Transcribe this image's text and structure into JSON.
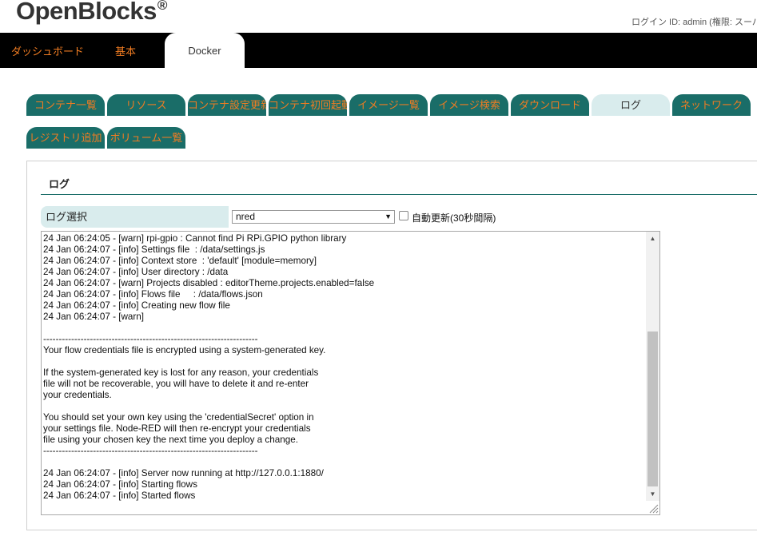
{
  "brand": {
    "name": "OpenBlocks",
    "reg": "®"
  },
  "login": {
    "text": "ログイン ID: admin (権限: スーパー"
  },
  "topnav": {
    "items": [
      {
        "label": "ダッシュボード"
      },
      {
        "label": "基本"
      },
      {
        "label": "Docker"
      }
    ],
    "active": "Docker"
  },
  "tabs": [
    {
      "label": "コンテナ一覧"
    },
    {
      "label": "リソース"
    },
    {
      "label": "コンテナ設定更新"
    },
    {
      "label": "コンテナ初回起動"
    },
    {
      "label": "イメージ一覧"
    },
    {
      "label": "イメージ検索"
    },
    {
      "label": "ダウンロード"
    },
    {
      "label": "ログ"
    },
    {
      "label": "ネットワーク"
    },
    {
      "label": "レジストリ追加"
    },
    {
      "label": "ボリューム一覧"
    }
  ],
  "active_tab": "ログ",
  "panel": {
    "title": "ログ",
    "log_select_label": "ログ選択",
    "selected_container": "nred",
    "auto_refresh_label": "自動更新(30秒間隔)",
    "auto_refresh_checked": false
  },
  "log": {
    "lines": [
      "24 Jan 06:24:05 - [warn] rpi-gpio : Cannot find Pi RPi.GPIO python library",
      "24 Jan 06:24:07 - [info] Settings file  : /data/settings.js",
      "24 Jan 06:24:07 - [info] Context store  : 'default' [module=memory]",
      "24 Jan 06:24:07 - [info] User directory : /data",
      "24 Jan 06:24:07 - [warn] Projects disabled : editorTheme.projects.enabled=false",
      "24 Jan 06:24:07 - [info] Flows file     : /data/flows.json",
      "24 Jan 06:24:07 - [info] Creating new flow file",
      "24 Jan 06:24:07 - [warn]",
      "",
      "---------------------------------------------------------------------",
      "Your flow credentials file is encrypted using a system-generated key.",
      "",
      "If the system-generated key is lost for any reason, your credentials",
      "file will not be recoverable, you will have to delete it and re-enter",
      "your credentials.",
      "",
      "You should set your own key using the 'credentialSecret' option in",
      "your settings file. Node-RED will then re-encrypt your credentials",
      "file using your chosen key the next time you deploy a change.",
      "---------------------------------------------------------------------",
      "",
      "24 Jan 06:24:07 - [info] Server now running at http://127.0.0.1:1880/",
      "24 Jan 06:24:07 - [info] Starting flows",
      "24 Jan 06:24:07 - [info] Started flows"
    ]
  },
  "icons": {
    "scroll_up": "scroll-up-arrow-icon",
    "scroll_down": "scroll-down-arrow-icon",
    "dropdown": "chevron-down-icon",
    "resize": "resize-grip-icon"
  },
  "colors": {
    "accent": "#f07c22",
    "tab_bg": "#1a6d68",
    "tab_active_bg": "#d9eced",
    "nav_bg": "#000000"
  }
}
